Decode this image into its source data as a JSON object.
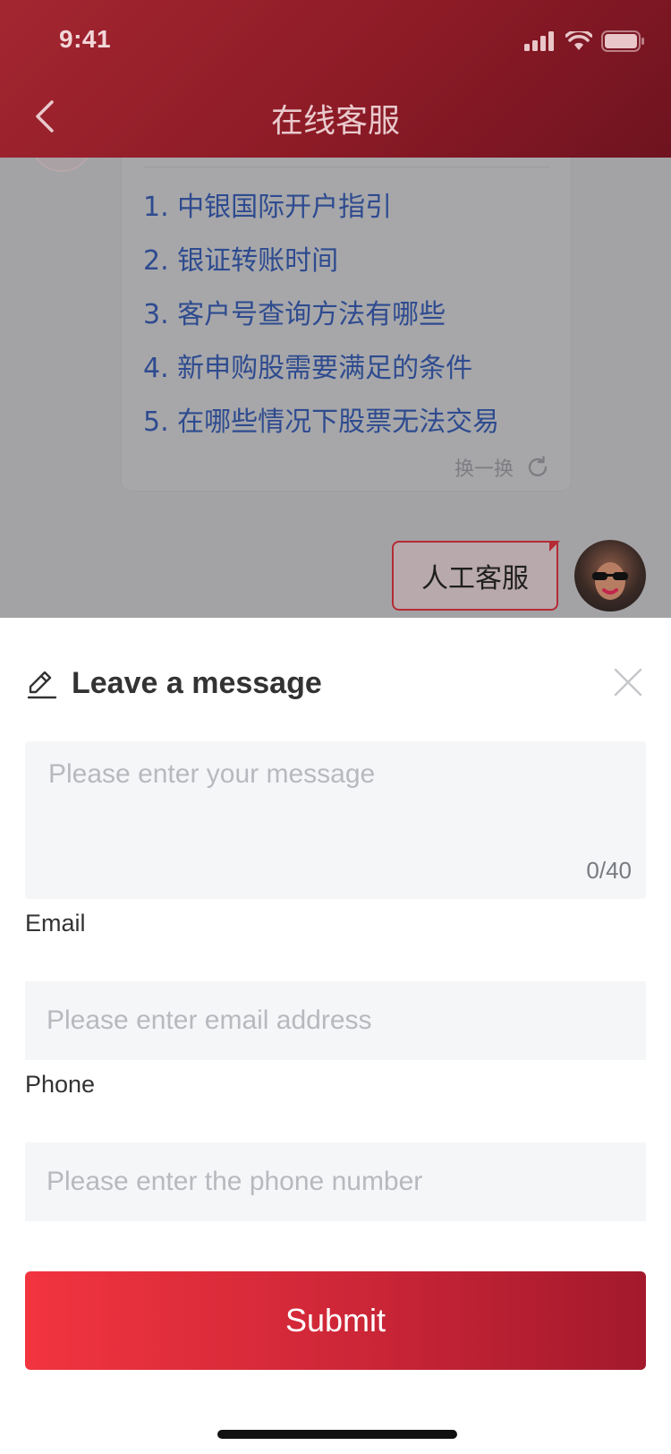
{
  "status_bar": {
    "time": "9:41"
  },
  "nav": {
    "title": "在线客服",
    "back_icon": "chevron-left-icon"
  },
  "faq": {
    "items": [
      "1. 中银国际开户指引",
      "2. 银证转账时间",
      "3. 客户号查询方法有哪些",
      "4. 新申购股需要满足的条件",
      "5. 在哪些情况下股票无法交易"
    ],
    "refresh_label": "换一换"
  },
  "chat": {
    "user_message": "人工客服"
  },
  "sheet": {
    "title": "Leave a message",
    "message_placeholder": "Please enter your message",
    "message_counter": "0/40",
    "email_label": "Email",
    "email_placeholder": "Please enter email address",
    "phone_label": "Phone",
    "phone_placeholder": "Please enter the phone number",
    "submit_label": "Submit"
  },
  "colors": {
    "brand_red": "#c8283a",
    "header_dark": "#7a1622",
    "link_blue": "#2e4b8f",
    "input_bg": "#f5f6f8"
  }
}
